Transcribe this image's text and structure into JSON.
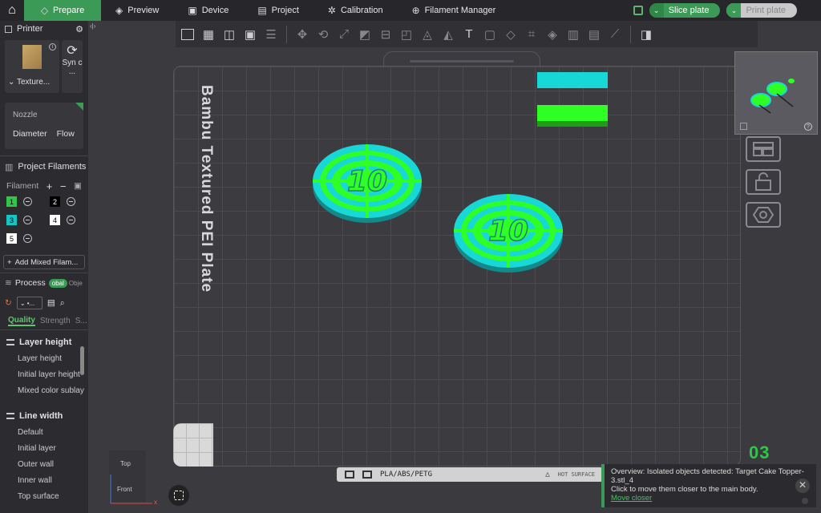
{
  "topbar": {
    "tabs": [
      {
        "label": "Prepare",
        "icon": "cube-icon",
        "active": true
      },
      {
        "label": "Preview",
        "icon": "layers-icon"
      },
      {
        "label": "Device",
        "icon": "device-icon"
      },
      {
        "label": "Project",
        "icon": "project-icon"
      },
      {
        "label": "Calibration",
        "icon": "calibration-icon"
      },
      {
        "label": "Filament Manager",
        "icon": "filament-manager-icon"
      }
    ],
    "slice_label": "Slice plate",
    "print_label": "Print plate",
    "accent": "#3b9a55"
  },
  "sidebar": {
    "printer_title": "Printer",
    "plate_caption": "Texture...",
    "sync_label": "Syn c ...",
    "nozzle_title": "Nozzle",
    "nozzle_diameter": "Diameter",
    "nozzle_flow": "Flow",
    "project_filaments": "Project Filaments",
    "filament_label": "Filament",
    "filaments": [
      {
        "num": "1",
        "color": "#2fc64a",
        "text_color": "#000"
      },
      {
        "num": "2",
        "color": "#000000",
        "text_color": "#fff"
      },
      {
        "num": "3",
        "color": "#17c3c3",
        "text_color": "#000"
      },
      {
        "num": "4",
        "color": "#ffffff",
        "text_color": "#000"
      },
      {
        "num": "5",
        "color": "#ffffff",
        "text_color": "#000"
      }
    ],
    "add_mixed": "Add Mixed Filam...",
    "process_title": "Process",
    "global_label": "obal",
    "object_label": "Obje",
    "preset_value": "•...",
    "qtab_quality": "Quality",
    "qtab_strength": "Strength",
    "qtab_more": "S...",
    "groups": [
      {
        "title": "Layer height",
        "options": [
          "Layer height",
          "Initial layer height",
          "Mixed color sublay"
        ]
      },
      {
        "title": "Line width",
        "options": [
          "Default",
          "Initial layer",
          "Outer wall",
          "Inner wall",
          "Top surface"
        ]
      }
    ]
  },
  "canvas": {
    "plate_label": "Bambu Textured PEI Plate",
    "plate_number": "03",
    "strip_text": "PLA/ABS/PETG",
    "strip_right": "HOT SURFACE",
    "objects": [
      {
        "label": "10"
      },
      {
        "label": "10"
      }
    ],
    "view_top": "Top",
    "view_front": "Front",
    "axis_x": "x"
  },
  "notice": {
    "line1": "Overview: Isolated objects detected: Target Cake Topper-3.stl_4",
    "line2": "Click to move them closer to the main body.",
    "link": "Move closer"
  }
}
